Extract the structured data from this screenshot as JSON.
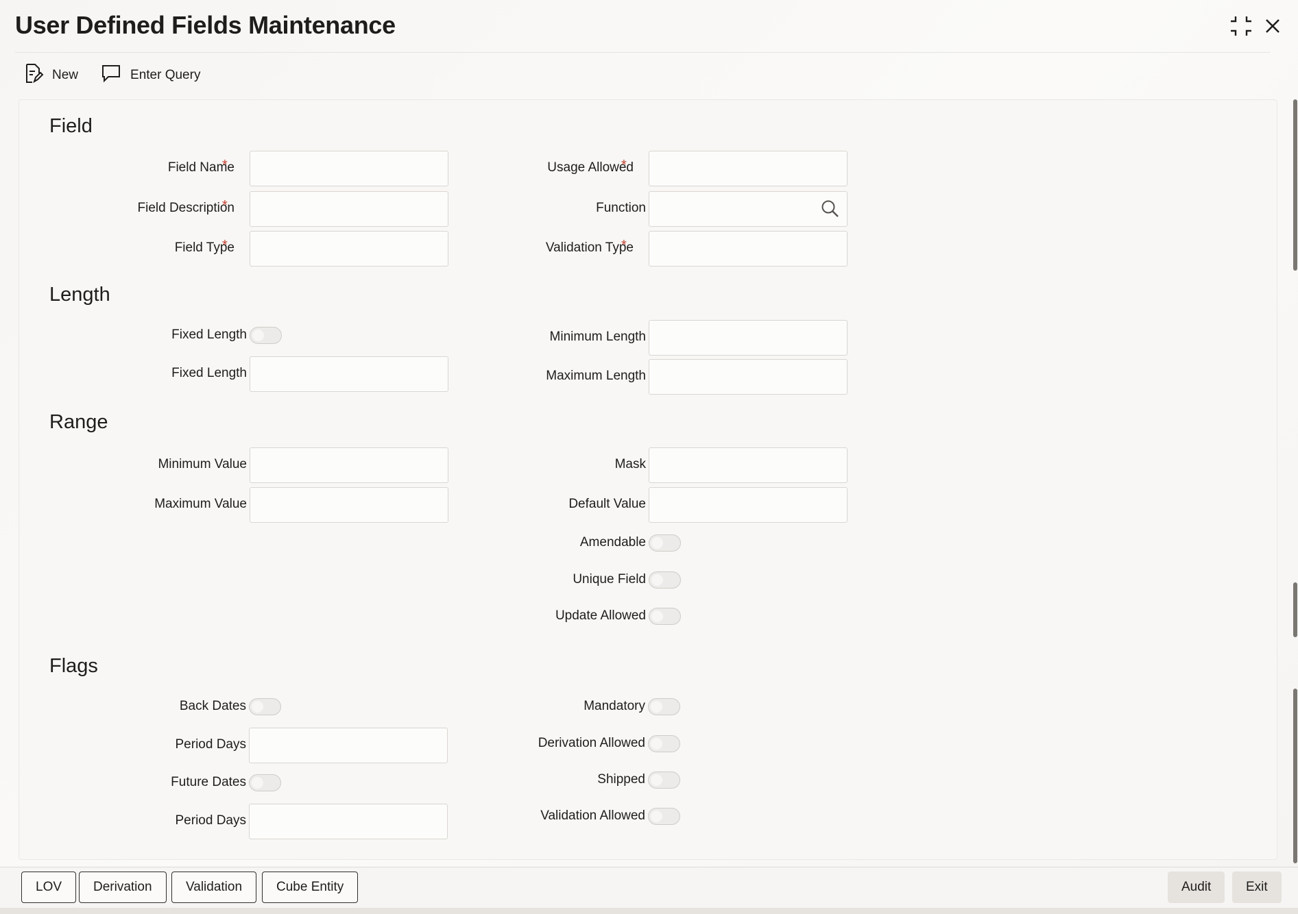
{
  "window": {
    "title": "User Defined Fields Maintenance"
  },
  "toolbar": {
    "new_label": "New",
    "enter_query_label": "Enter Query"
  },
  "sections": {
    "field": "Field",
    "length": "Length",
    "range": "Range",
    "flags": "Flags"
  },
  "field": {
    "field_name": "Field Name",
    "field_description": "Field Description",
    "field_type": "Field Type",
    "usage_allowed": "Usage Allowed",
    "function": "Function",
    "validation_type": "Validation Type",
    "required_marker": "*"
  },
  "length": {
    "fixed_length_toggle": "Fixed Length",
    "fixed_length_input": "Fixed Length",
    "minimum_length": "Minimum Length",
    "maximum_length": "Maximum Length"
  },
  "range": {
    "minimum_value": "Minimum Value",
    "maximum_value": "Maximum Value",
    "mask": "Mask",
    "default_value": "Default Value",
    "amendable": "Amendable",
    "unique_field": "Unique Field",
    "update_allowed": "Update Allowed"
  },
  "flags": {
    "back_dates": "Back Dates",
    "period_days_1": "Period Days",
    "future_dates": "Future Dates",
    "period_days_2": "Period Days",
    "mandatory": "Mandatory",
    "derivation_allowed": "Derivation Allowed",
    "shipped": "Shipped",
    "validation_allowed": "Validation Allowed"
  },
  "footer": {
    "lov": "LOV",
    "derivation": "Derivation",
    "validation": "Validation",
    "cube_entity": "Cube Entity",
    "audit": "Audit",
    "exit": "Exit"
  },
  "icons": {
    "new": "new-document-icon",
    "enter_query": "speech-bubble-icon",
    "search": "search-icon",
    "minimize": "collapse-icon",
    "close": "close-icon"
  },
  "toggles_state": {
    "fixed_length": false,
    "amendable": false,
    "unique_field": false,
    "update_allowed": false,
    "back_dates": false,
    "future_dates": false,
    "mandatory": false,
    "derivation_allowed": false,
    "shipped": false,
    "validation_allowed": false
  },
  "colors": {
    "required": "#c74634",
    "scrollbar": "#7a7773",
    "panel": "#f8f7f5"
  }
}
